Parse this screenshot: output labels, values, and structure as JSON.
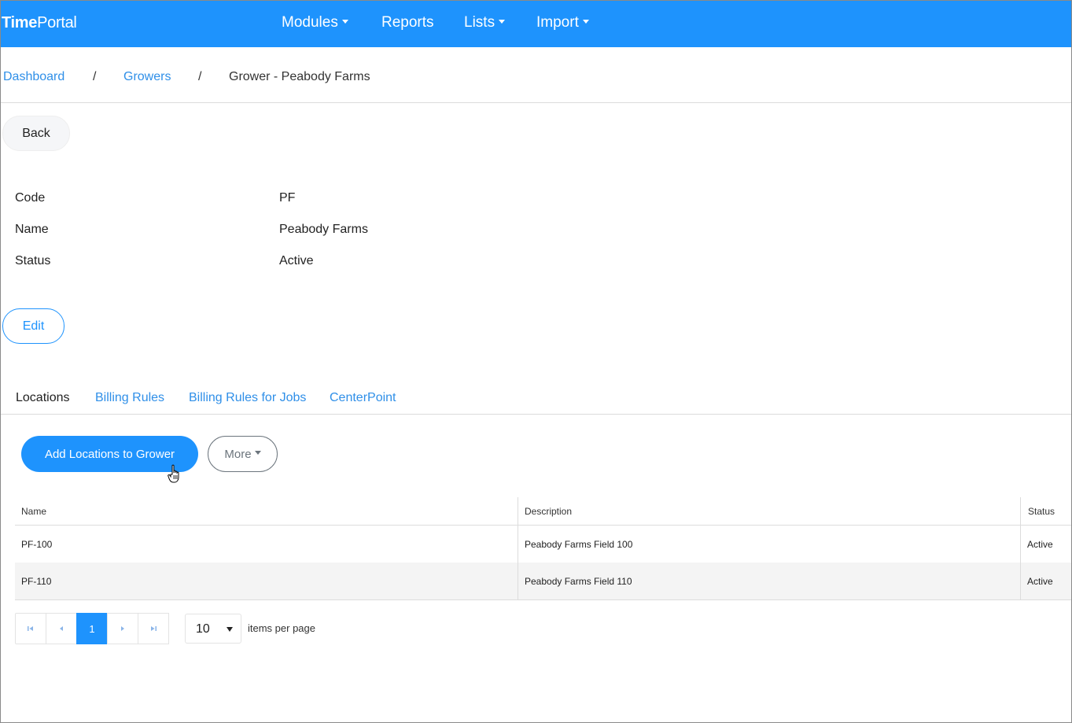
{
  "navbar": {
    "brand_bold": "Time",
    "brand_light": "Portal",
    "items": [
      {
        "label": "Modules",
        "has_caret": true
      },
      {
        "label": "Reports",
        "has_caret": false
      },
      {
        "label": "Lists",
        "has_caret": true
      },
      {
        "label": "Import",
        "has_caret": true
      }
    ],
    "color": "#1e93fd"
  },
  "breadcrumb": {
    "items": [
      "Dashboard",
      "Growers",
      "Grower - Peabody Farms"
    ],
    "separator": "/"
  },
  "back_label": "Back",
  "details": [
    {
      "label": "Code",
      "value": "PF"
    },
    {
      "label": "Name",
      "value": "Peabody Farms"
    },
    {
      "label": "Status",
      "value": "Active"
    }
  ],
  "edit_label": "Edit",
  "tabs": [
    {
      "label": "Locations",
      "active": true
    },
    {
      "label": "Billing Rules",
      "active": false
    },
    {
      "label": "Billing Rules for Jobs",
      "active": false
    },
    {
      "label": "CenterPoint",
      "active": false
    }
  ],
  "actions": {
    "add_label": "Add Locations to Grower",
    "more_label": "More"
  },
  "grid": {
    "columns": [
      "Name",
      "Description",
      "Status"
    ],
    "rows": [
      [
        "PF-100",
        "Peabody Farms Field 100",
        "Active"
      ],
      [
        "PF-110",
        "Peabody Farms Field 110",
        "Active"
      ]
    ]
  },
  "pager": {
    "current_page": "1",
    "page_size": "10",
    "items_per_page_label": "items per page"
  }
}
